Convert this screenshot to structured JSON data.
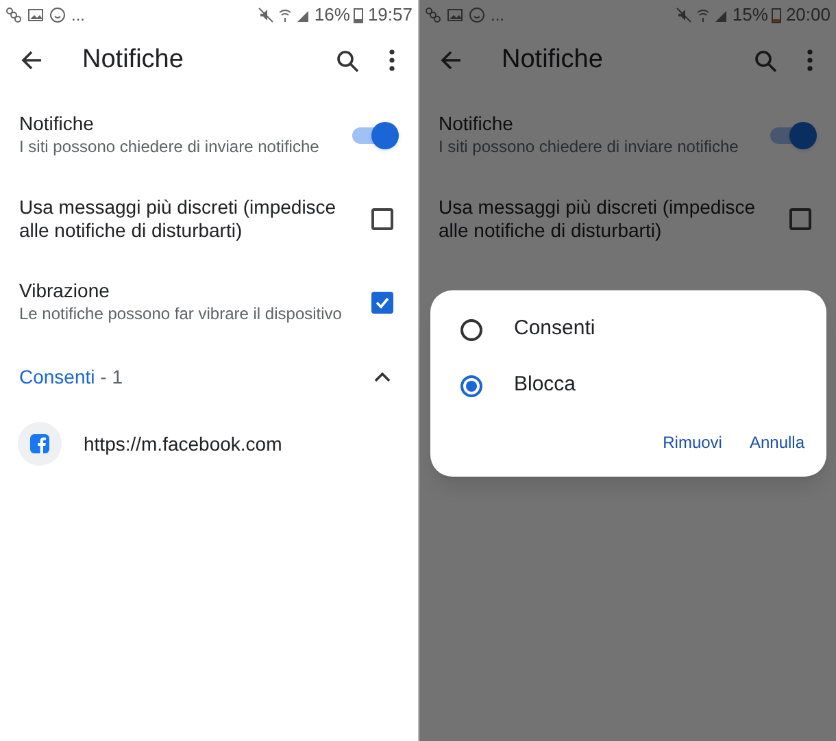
{
  "panes": [
    {
      "dimmed": false,
      "status_bar": {
        "more": "...",
        "battery": "16%",
        "time": "19:57"
      },
      "toolbar": {
        "title": "Notifiche"
      },
      "settings": [
        {
          "kind": "toggle",
          "title": "Notifiche",
          "subtitle": "I siti possono chiedere di inviare notifiche",
          "on": true
        },
        {
          "kind": "checkbox",
          "title": "Usa messaggi più discreti (impedisce alle notifiche di disturbarti)",
          "checked": false
        },
        {
          "kind": "checkbox",
          "title": "Vibrazione",
          "subtitle": "Le notifiche possono far vibrare il dispositivo",
          "checked": true
        }
      ],
      "section": {
        "label": "Consenti",
        "count": "- 1",
        "expanded": true
      },
      "sites": [
        {
          "url": "https://m.facebook.com"
        }
      ]
    },
    {
      "dimmed": true,
      "status_bar": {
        "more": "...",
        "battery": "15%",
        "time": "20:00"
      },
      "toolbar": {
        "title": "Notifiche"
      },
      "settings": [
        {
          "kind": "toggle",
          "title": "Notifiche",
          "subtitle": "I siti possono chiedere di inviare notifiche",
          "on": true
        },
        {
          "kind": "checkbox",
          "title": "Usa messaggi più discreti (impedisce alle notifiche di disturbarti)",
          "checked": false
        }
      ],
      "dialog": {
        "options": [
          {
            "label": "Consenti",
            "selected": false
          },
          {
            "label": "Blocca",
            "selected": true
          }
        ],
        "buttons": [
          "Rimuovi",
          "Annulla"
        ]
      }
    }
  ]
}
